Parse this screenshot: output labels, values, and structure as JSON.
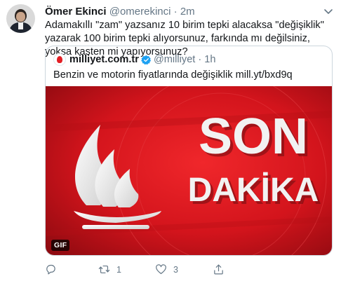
{
  "tweet": {
    "author_name": "Ömer Ekinci",
    "author_handle": "@omerekinci",
    "separator": "·",
    "time": "2m",
    "text": "Adamakıllı \"zam\" yazsanız 10 birim tepki alacaksa \"değişiklik\" yazarak 100 birim tepki alıyorsunuz, farkında mı değilsiniz, yoksa kasten mi yapıyorsunuz?"
  },
  "quote": {
    "author_name": "milliyet.com.tr",
    "author_handle": "@milliyet",
    "separator": "·",
    "time": "1h",
    "text": "Benzin ve motorin fiyatlarında değişiklik mill.yt/bxd9q",
    "media": {
      "headline_line1": "SON",
      "headline_line2": "DAKİKA",
      "badge": "GIF"
    }
  },
  "actions": {
    "reply_count": "",
    "retweet_count": "1",
    "like_count": "3"
  },
  "colors": {
    "text_primary": "#14171a",
    "text_muted": "#657786",
    "verified": "#1da1f2",
    "breaking_red": "#d3141c",
    "border": "#ccd6dd"
  },
  "icons": {
    "caret": "chevron-down-icon",
    "verified": "verified-badge-icon",
    "reply": "reply-icon",
    "retweet": "retweet-icon",
    "like": "heart-icon",
    "share": "share-icon"
  }
}
